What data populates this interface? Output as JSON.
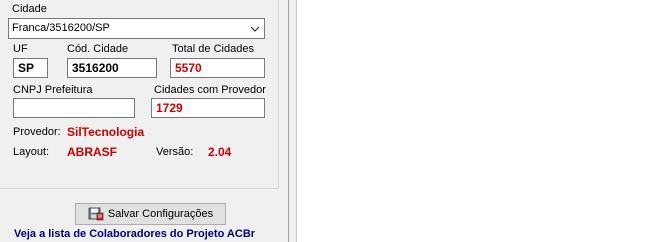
{
  "cidade": {
    "label": "Cidade",
    "selected": "Franca/3516200/SP"
  },
  "uf": {
    "label": "UF",
    "value": "SP"
  },
  "cod_cidade": {
    "label": "Cód. Cidade",
    "value": "3516200"
  },
  "total_cidades": {
    "label": "Total de Cidades",
    "value": "5570"
  },
  "cnpj": {
    "label": "CNPJ Prefeitura",
    "value": ""
  },
  "cidades_provedor": {
    "label": "Cidades com Provedor",
    "value": "1729"
  },
  "provedor": {
    "label": "Provedor:",
    "value": "SilTecnologia"
  },
  "layout": {
    "label": "Layout:",
    "value": "ABRASF"
  },
  "versao": {
    "label": "Versão:",
    "value": "2.04"
  },
  "save_button": {
    "label": "Salvar Configurações",
    "icon": "save-settings-icon"
  },
  "collaborators_link": "Veja a lista de Colaboradores do Projeto ACBr",
  "colors": {
    "value_red": "#d00000",
    "link_navy": "#000080",
    "panel": "#f0f0f0"
  }
}
